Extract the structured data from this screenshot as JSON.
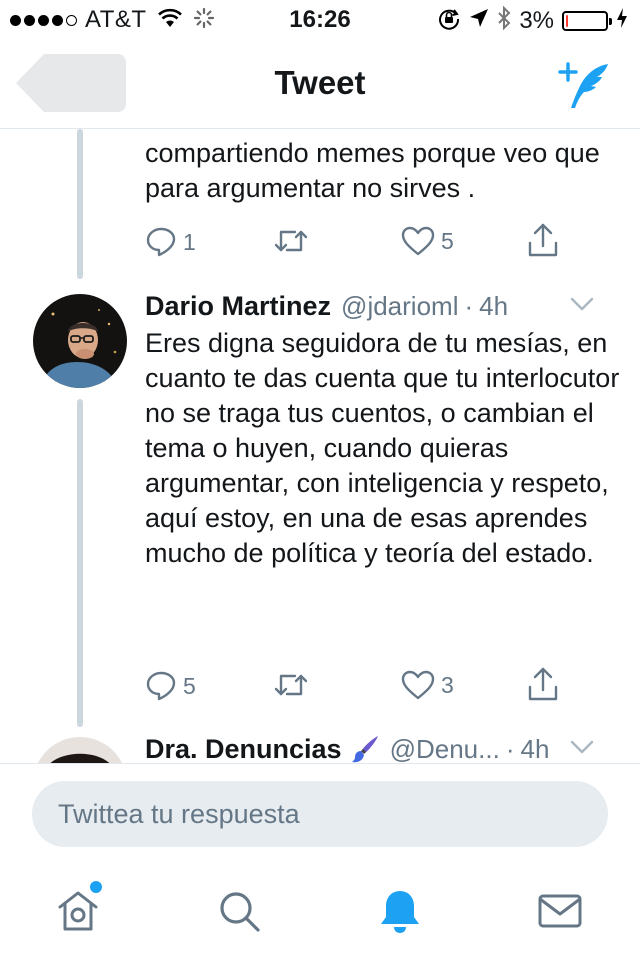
{
  "status_bar": {
    "carrier": "AT&T",
    "time": "16:26",
    "battery_percent": "3%",
    "battery_level": 0.03,
    "signal_bars_filled": 4,
    "signal_bars_total": 5
  },
  "nav": {
    "title": "Tweet",
    "compose_icon": "compose-tweet-icon"
  },
  "tweets": [
    {
      "text": "compartiendo memes porque veo que para argumentar no sirves .",
      "actions": {
        "replies": "1",
        "retweets": "",
        "likes": "5"
      }
    },
    {
      "name": "Dario Martinez",
      "handle": "@jdarioml",
      "separator": "·",
      "time": "4h",
      "text": "Eres digna seguidora de tu mesías, en cuanto te das cuenta que tu interlocutor no se traga tus cuentos, o cambian el tema o huyen, cuando quieras argumentar, con inteligencia y respeto, aquí estoy, en una de esas aprendes mucho de política y teoría del estado.",
      "actions": {
        "replies": "5",
        "retweets": "",
        "likes": "3"
      }
    },
    {
      "name": "Dra. Denuncias",
      "name_emoji": "paintbrush-emoji",
      "handle": "@Denu...",
      "separator": "·",
      "time": "4h"
    }
  ],
  "reply": {
    "placeholder": "Twittea tu respuesta"
  },
  "tabs": [
    {
      "name": "home",
      "icon": "home-icon",
      "has_notification_dot": true
    },
    {
      "name": "search",
      "icon": "search-icon"
    },
    {
      "name": "notifications",
      "icon": "bell-icon",
      "active": true
    },
    {
      "name": "messages",
      "icon": "mail-icon"
    }
  ],
  "colors": {
    "accent": "#1da1f2",
    "muted": "#657786",
    "divider": "#e1e8ed",
    "thread_line": "#ccd6dd",
    "battery_low": "#ff3b30"
  }
}
